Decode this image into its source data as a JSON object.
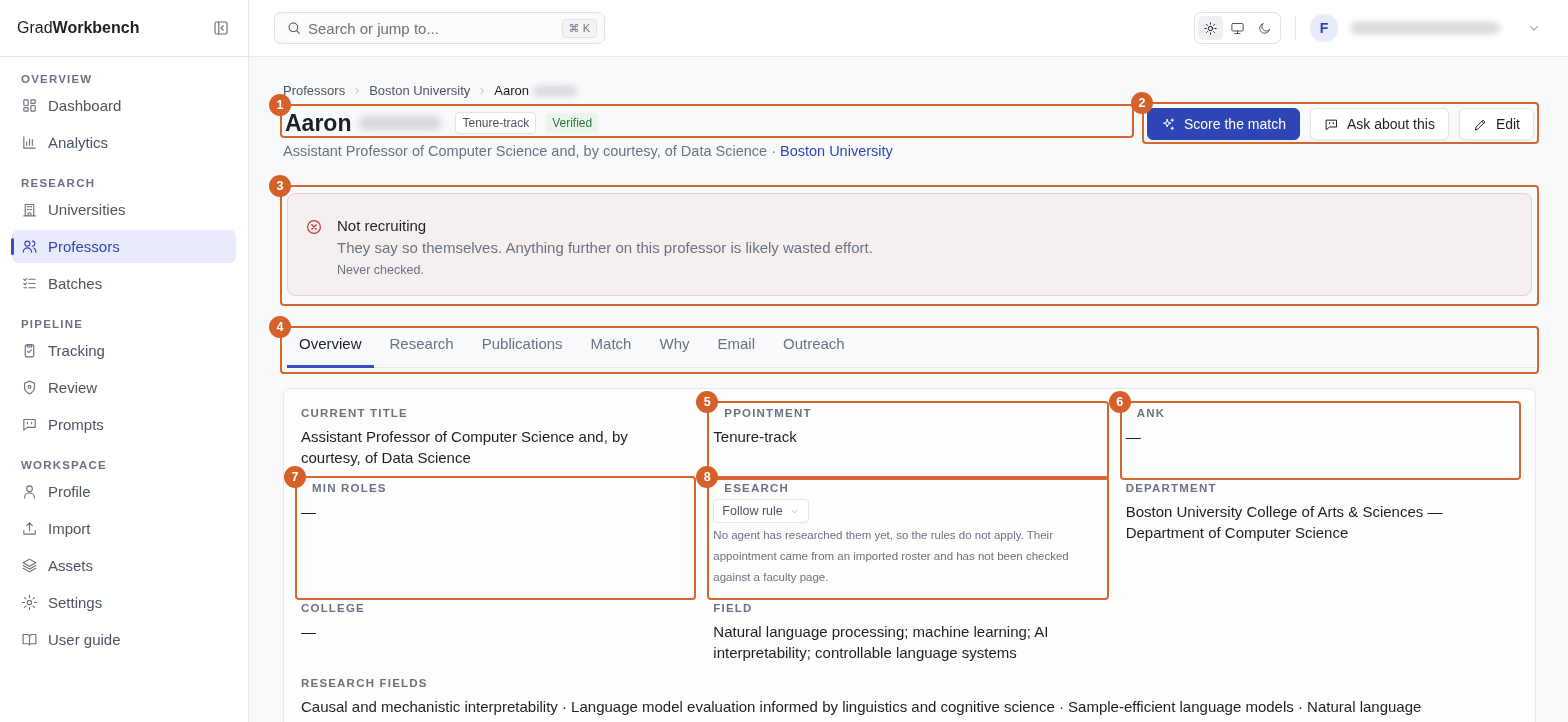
{
  "app": {
    "logo": "Grad**Workbench**"
  },
  "search": {
    "placeholder": "Search or jump to...",
    "shortcut": "⌘ K"
  },
  "theme_options": [
    {
      "selected": true
    },
    {
      "selected": false
    },
    {
      "selected": false
    }
  ],
  "user": {
    "avatar_letter": "F"
  },
  "sidebar": {
    "groups": [
      {
        "heading": "OVERVIEW",
        "items": [
          {
            "label": "Dashboard",
            "selected": false
          },
          {
            "label": "Analytics",
            "selected": false
          }
        ]
      },
      {
        "heading": "RESEARCH",
        "items": [
          {
            "label": "Universities",
            "selected": false
          },
          {
            "label": "Professors",
            "selected": true
          },
          {
            "label": "Batches",
            "selected": false
          }
        ]
      },
      {
        "heading": "PIPELINE",
        "items": [
          {
            "label": "Tracking",
            "selected": false
          },
          {
            "label": "Review",
            "selected": false
          },
          {
            "label": "Prompts",
            "selected": false
          }
        ]
      },
      {
        "heading": "WORKSPACE",
        "items": [
          {
            "label": "Profile",
            "selected": false
          },
          {
            "label": "Import",
            "selected": false
          },
          {
            "label": "Assets",
            "selected": false
          },
          {
            "label": "Settings",
            "selected": false
          },
          {
            "label": "User guide",
            "selected": false
          }
        ]
      }
    ]
  },
  "breadcrumb": [
    "Professors",
    "Boston University",
    "Aaron"
  ],
  "header": {
    "annotation": "1",
    "first_name": "Aaron",
    "badges": [
      {
        "label": "Tenure-track",
        "kind": "outline"
      },
      {
        "label": "Verified",
        "kind": "success"
      }
    ],
    "subtitle": "Assistant Professor of Computer Science and, by courtesy, of Data Science ·",
    "subtitle_link": "Boston University"
  },
  "actions": {
    "annotation": "2",
    "buttons": [
      {
        "label": "Score the match",
        "kind": "primary"
      },
      {
        "label": "Ask about this",
        "kind": "chat"
      },
      {
        "label": "Edit",
        "kind": "edit"
      }
    ]
  },
  "alert": {
    "annotation": "3",
    "title": "Not recruiting",
    "message": "They say so themselves. Anything further on this professor is likely wasted effort.",
    "note": "Never checked."
  },
  "tabs": {
    "annotation": "4",
    "items": [
      {
        "label": "Overview",
        "selected": true
      },
      {
        "label": "Research",
        "selected": false
      },
      {
        "label": "Publications",
        "selected": false
      },
      {
        "label": "Match",
        "selected": false
      },
      {
        "label": "Why",
        "selected": false
      },
      {
        "label": "Email",
        "selected": false
      },
      {
        "label": "Outreach",
        "selected": false
      }
    ]
  },
  "fields": [
    {
      "kind": "text",
      "label": "CURRENT TITLE",
      "value": "Assistant Professor of Computer Science and, by courtesy, of Data Science"
    },
    {
      "kind": "text",
      "label": "PPOINTMENT",
      "value": "Tenure-track",
      "annotation": "5"
    },
    {
      "kind": "text",
      "label": "ANK",
      "value": "—",
      "annotation": "6"
    },
    {
      "kind": "text",
      "label": "MIN ROLES",
      "value": "—",
      "annotation": "7"
    },
    {
      "kind": "select",
      "label": "ESEARCH",
      "value": "Follow rule",
      "note": "No agent has researched them yet, so the rules do not apply. Their appointment came from an imported roster and has not been checked against a faculty page.",
      "annotation": "8"
    },
    {
      "kind": "text",
      "label": "DEPARTMENT",
      "value": "Boston University College of Arts & Sciences — Department of Computer Science"
    },
    {
      "kind": "text",
      "label": "COLLEGE",
      "value": "—"
    },
    {
      "kind": "text",
      "label": "FIELD",
      "value": "Natural language processing; machine learning; AI interpretability; controllable language systems"
    },
    {
      "kind": "wide",
      "label": "RESEARCH FIELDS",
      "value": "Causal and mechanistic interpretability · Language model evaluation informed by linguistics and cognitive science · Sample-efficient language models · Natural language"
    }
  ]
}
